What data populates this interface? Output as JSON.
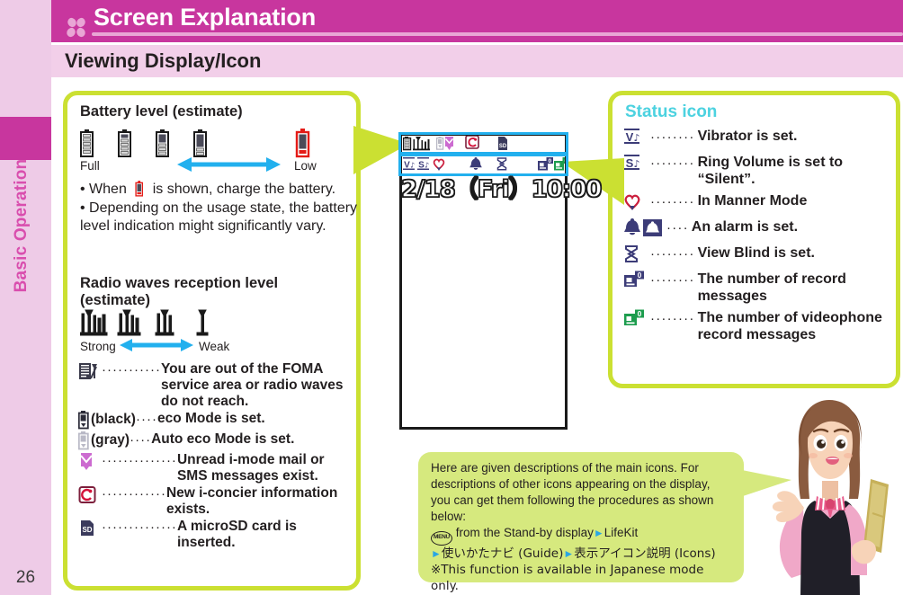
{
  "sidebar": {
    "chapter_label": "Basic Operation",
    "page_number": "26",
    "tab_color": "#c8369e",
    "bg_color": "#eecbe7"
  },
  "header": {
    "title": "Screen Explanation",
    "subtitle": "Viewing Display/Icon",
    "flower_icon": "flower-icon",
    "banner_color": "#c8369e",
    "subbar_color": "#f2cfe9"
  },
  "left_panel": {
    "battery_title": "Battery level (estimate)",
    "battery_icons": [
      "battery-full-icon",
      "battery-high-icon",
      "battery-mid-icon",
      "battery-low-icon",
      "battery-empty-red-icon"
    ],
    "battery_scale_left": "Full",
    "battery_scale_right": "Low",
    "bullet_1_pre": "• When",
    "bullet_1_post": "is shown, charge the battery.",
    "bullet_2": "• Depending on the usage state, the battery level indication might significantly vary.",
    "radio_title": "Radio waves reception level (estimate)",
    "radio_icons": [
      "antenna-4bar-icon",
      "antenna-3bar-icon",
      "antenna-2bar-icon",
      "antenna-1bar-icon"
    ],
    "radio_scale_left": "Strong",
    "radio_scale_right": "Weak",
    "items": [
      {
        "icon": "out-of-service-area-icon",
        "dots": "···········",
        "paren": "",
        "text": "You are out of the FOMA service area or radio waves do not reach."
      },
      {
        "icon": "eco-mode-black-icon",
        "dots": "····",
        "paren": "(black)",
        "text": "eco Mode is set."
      },
      {
        "icon": "eco-mode-gray-icon",
        "dots": "····",
        "paren": "(gray)",
        "text": "Auto eco Mode is set."
      },
      {
        "icon": "unread-mail-icon",
        "dots": "··············",
        "paren": "",
        "text": "Unread i-mode mail or SMS messages exist."
      },
      {
        "icon": "i-concier-icon",
        "dots": "············",
        "paren": "",
        "text": "New i-concier information exists."
      },
      {
        "icon": "microsd-icon",
        "dots": "··············",
        "paren": "",
        "text": "A microSD card is inserted."
      }
    ]
  },
  "right_panel": {
    "title": "Status icon",
    "title_color": "#4cd2e0",
    "items": [
      {
        "icons": [
          "vibrator-icon"
        ],
        "dots": "········",
        "text": "Vibrator is set."
      },
      {
        "icons": [
          "silent-icon"
        ],
        "dots": "········",
        "text": "Ring Volume is set to “Silent”."
      },
      {
        "icons": [
          "manner-mode-icon"
        ],
        "dots": "········",
        "text": "In Manner Mode"
      },
      {
        "icons": [
          "alarm-bell-filled-icon",
          "alarm-bell-outline-icon"
        ],
        "dots": "····",
        "text": "An alarm is set."
      },
      {
        "icons": [
          "view-blind-icon"
        ],
        "dots": "········",
        "text": "View Blind is set."
      },
      {
        "icons": [
          "record-message-icon"
        ],
        "dots": "········",
        "text": "The number of record messages"
      },
      {
        "icons": [
          "videophone-record-icon"
        ],
        "dots": "········",
        "text": "The number of videophone record messages"
      }
    ]
  },
  "phone_display": {
    "status_row_1": [
      "battery-icon",
      "antenna-icon",
      "eco-mode-icon",
      "unread-mail-icon",
      "i-concier-icon",
      "microsd-icon"
    ],
    "status_row_2": [
      "vibrator-icon",
      "silent-icon",
      "manner-mode-icon",
      "alarm-bell-icon",
      "view-blind-icon",
      "record-message-icon",
      "videophone-record-icon"
    ],
    "datetime": "2/18（Fri）10:00",
    "highlight_color": "#22b0ee"
  },
  "callout": {
    "line_1": "Here are given descriptions of the main icons. For",
    "line_2": "descriptions of other icons appearing on the display,",
    "line_3": "you can get them following the procedures as shown",
    "line_4": "below:",
    "menu_key": "MENU",
    "line_5a": "from the Stand-by display",
    "line_5b": "LifeKit",
    "line_6a": "使いかたナビ (Guide)",
    "line_6b": "表示アイコン説明 (Icons)",
    "line_7": "※This function is available in Japanese mode only.",
    "bg_color": "#d6e97e"
  },
  "illustration": {
    "name": "woman-with-phone-illustration"
  }
}
